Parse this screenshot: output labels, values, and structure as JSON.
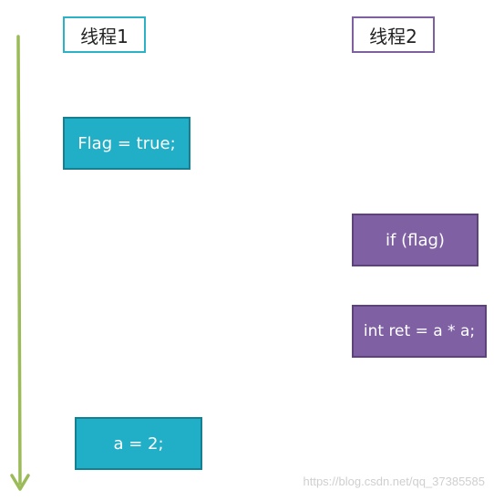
{
  "colors": {
    "timeline_arrow": "#9bbb59",
    "thread1_accent": "#21aec7",
    "thread2_accent": "#7e60a3"
  },
  "threads": [
    {
      "label": "线程1"
    },
    {
      "label": "线程2"
    }
  ],
  "steps": {
    "thread1": [
      "Flag = true;",
      "a = 2;"
    ],
    "thread2": [
      "if (flag)",
      "int ret = a * a;"
    ]
  },
  "watermark": "https://blog.csdn.net/qq_37385585"
}
